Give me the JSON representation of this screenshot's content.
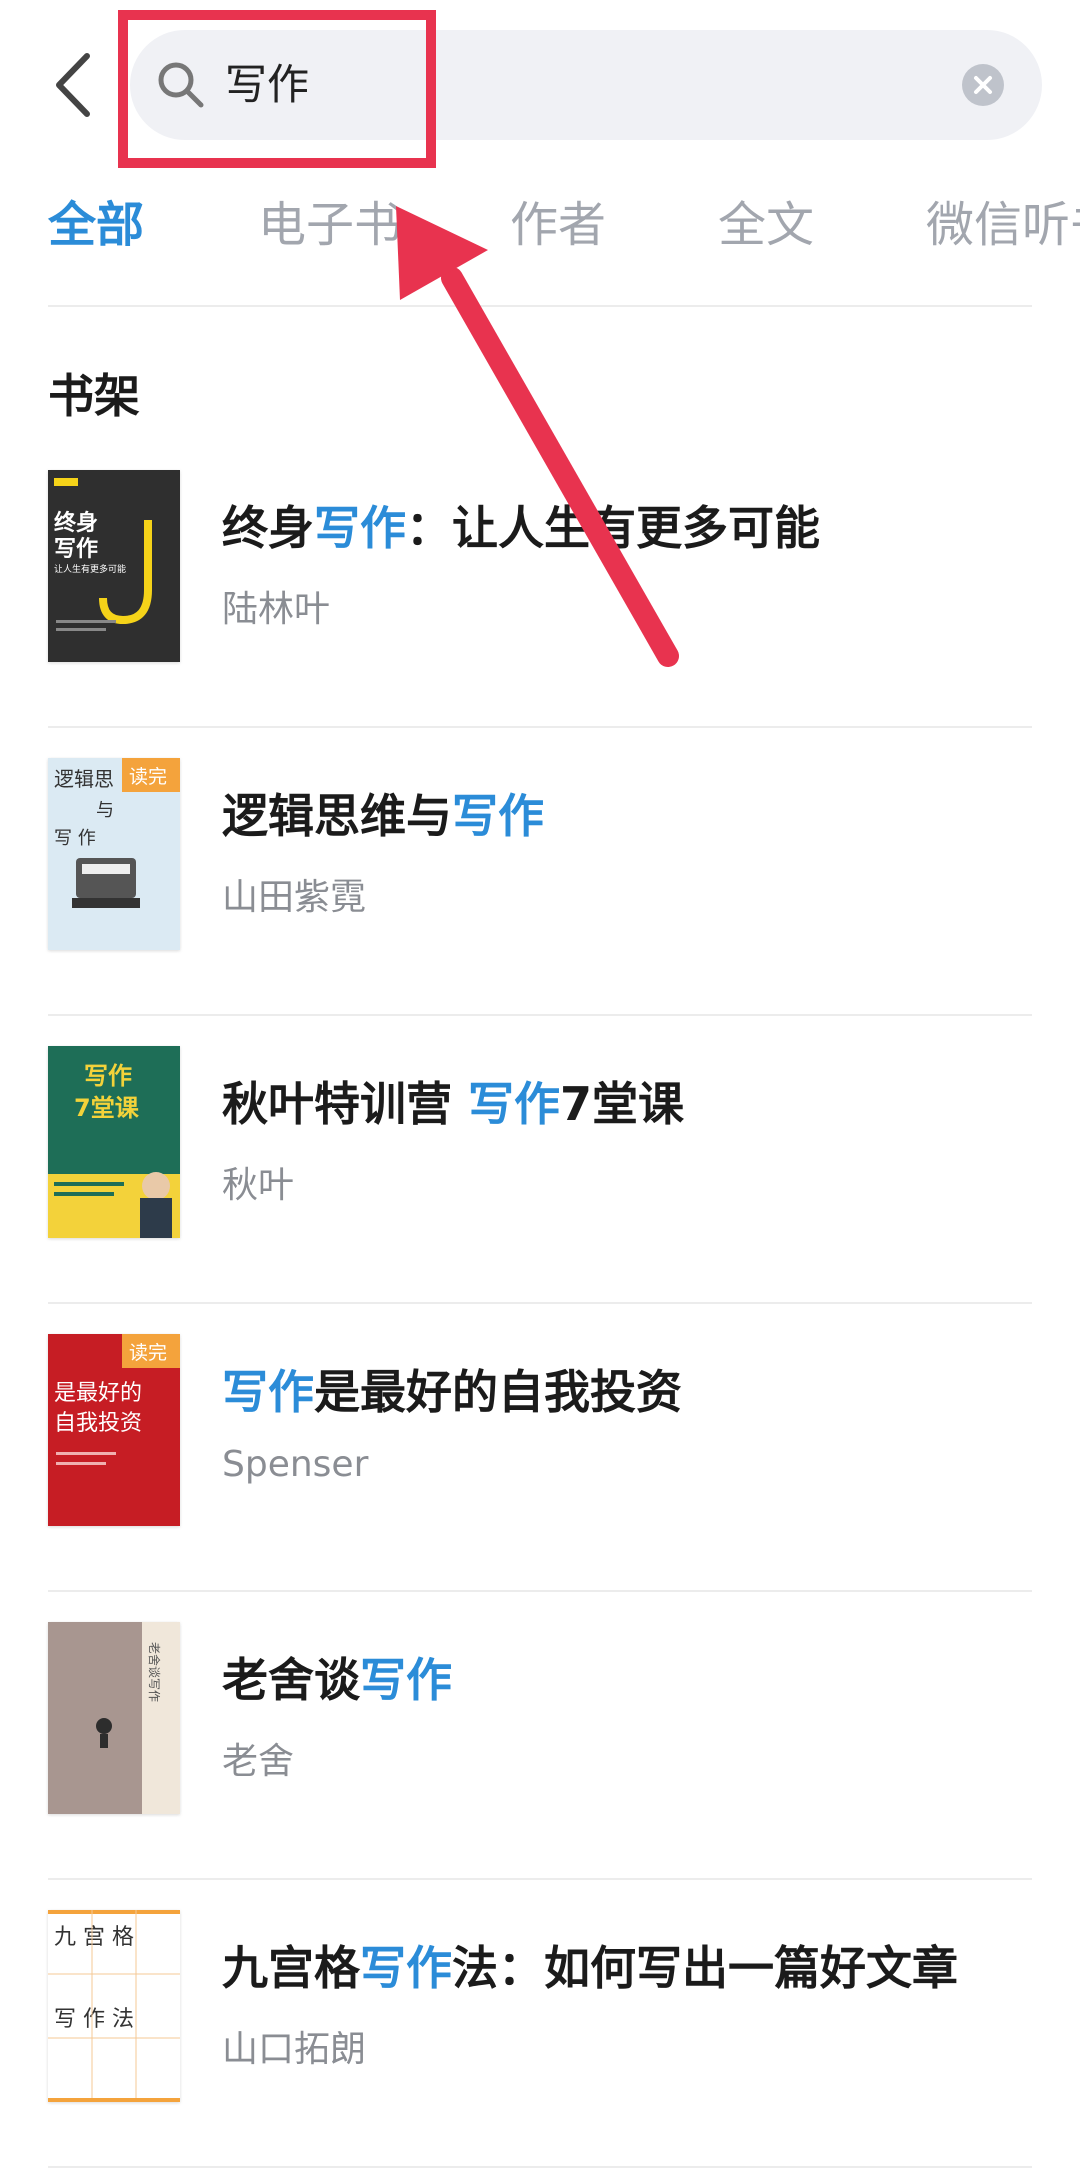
{
  "search": {
    "query": "写作"
  },
  "tabs": [
    {
      "label": "全部",
      "active": true
    },
    {
      "label": "电子书",
      "active": false
    },
    {
      "label": "作者",
      "active": false
    },
    {
      "label": "全文",
      "active": false
    },
    {
      "label": "微信听书",
      "active": false
    }
  ],
  "shelf": {
    "title": "书架",
    "books": [
      {
        "title_pre": "终身",
        "title_hl": "写作",
        "title_post": "：让人生有更多可能",
        "author": "陆林叶",
        "cover": {
          "bg": "#2f2f2f",
          "lines": [
            "终身",
            "写作"
          ],
          "sub": "让人生有更多可能",
          "badge": "",
          "accent": "#f5d319"
        }
      },
      {
        "title_pre": "逻辑思维与",
        "title_hl": "写作",
        "title_post": "",
        "author": "山田紫霓",
        "cover": {
          "bg": "#dbeaf3",
          "lines": [
            "逻辑思",
            "与",
            "写    作"
          ],
          "sub": "",
          "badge": "读完",
          "accent": "#333333"
        }
      },
      {
        "title_pre": "秋叶特训营 ",
        "title_hl": "写作",
        "title_post": "7堂课",
        "author": "秋叶",
        "cover": {
          "bg": "#1e6e57",
          "lines": [
            "写作",
            "7堂课"
          ],
          "sub": "",
          "badge": "",
          "accent": "#f3d23a"
        }
      },
      {
        "title_pre": "",
        "title_hl": "写作",
        "title_post": "是最好的自我投资",
        "author": "Spenser",
        "cover": {
          "bg": "#c61d24",
          "lines": [
            "是最好的",
            "自我投资"
          ],
          "sub": "",
          "badge": "读完",
          "accent": "#ffffff"
        }
      },
      {
        "title_pre": "老舍谈",
        "title_hl": "写作",
        "title_post": "",
        "author": "老舍",
        "cover": {
          "bg": "#a89690",
          "lines": [
            "老舍谈写作"
          ],
          "sub": "",
          "badge": "",
          "accent": "#f0e7da"
        }
      },
      {
        "title_pre": "九宫格",
        "title_hl": "写作",
        "title_post": "法：如何写出一篇好文章",
        "author": "山口拓朗",
        "cover": {
          "bg": "#ffffff",
          "lines": [
            "九 宫 格",
            "写 作 法"
          ],
          "sub": "",
          "badge": "",
          "accent": "#333333"
        }
      }
    ]
  },
  "colors": {
    "accent_blue": "#2b8cd8",
    "annotation_red": "#e8334f",
    "badge_orange": "#f4a33c"
  },
  "icons": {
    "back": "chevron-left-icon",
    "search": "search-icon",
    "clear": "clear-circle-icon"
  }
}
